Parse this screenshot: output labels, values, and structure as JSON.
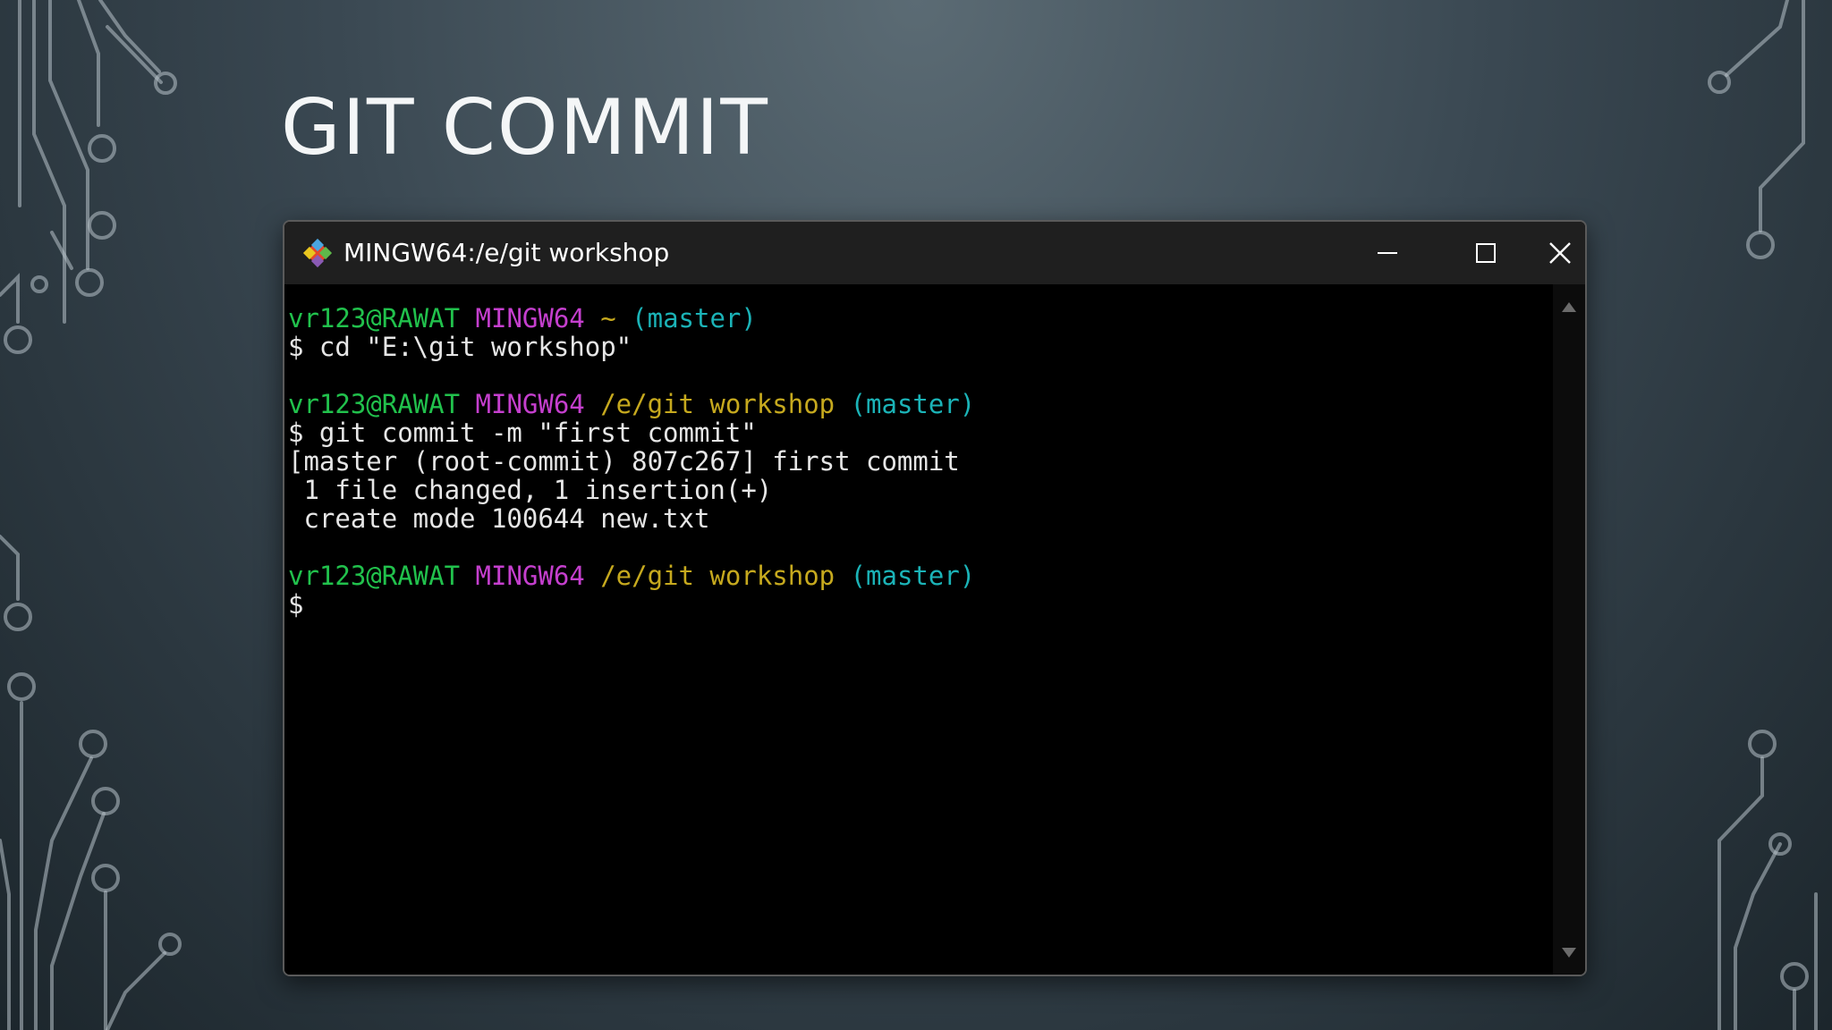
{
  "slide": {
    "title": "GIT COMMIT"
  },
  "window": {
    "title": "MINGW64:/e/git workshop",
    "icon": "git-for-windows-icon",
    "buttons": [
      "minimize-icon",
      "maximize-icon",
      "close-icon"
    ]
  },
  "terminal": {
    "lines": [
      [
        {
          "text": "vr123@RAWAT",
          "role": "user"
        },
        {
          "text": " ",
          "role": "plain"
        },
        {
          "text": "MINGW64",
          "role": "host"
        },
        {
          "text": " ",
          "role": "plain"
        },
        {
          "text": "~",
          "role": "path"
        },
        {
          "text": " ",
          "role": "plain"
        },
        {
          "text": "(master)",
          "role": "branch"
        }
      ],
      [
        {
          "text": "$ cd \"E:\\git workshop\"",
          "role": "plain"
        }
      ],
      [],
      [
        {
          "text": "vr123@RAWAT",
          "role": "user"
        },
        {
          "text": " ",
          "role": "plain"
        },
        {
          "text": "MINGW64",
          "role": "host"
        },
        {
          "text": " ",
          "role": "plain"
        },
        {
          "text": "/e/git workshop",
          "role": "path"
        },
        {
          "text": " ",
          "role": "plain"
        },
        {
          "text": "(master)",
          "role": "branch"
        }
      ],
      [
        {
          "text": "$ git commit -m \"first commit\"",
          "role": "plain"
        }
      ],
      [
        {
          "text": "[master (root-commit) 807c267] first commit",
          "role": "plain"
        }
      ],
      [
        {
          "text": " 1 file changed, 1 insertion(+)",
          "role": "plain"
        }
      ],
      [
        {
          "text": " create mode 100644 new.txt",
          "role": "plain"
        }
      ],
      [],
      [
        {
          "text": "vr123@RAWAT",
          "role": "user"
        },
        {
          "text": " ",
          "role": "plain"
        },
        {
          "text": "MINGW64",
          "role": "host"
        },
        {
          "text": " ",
          "role": "plain"
        },
        {
          "text": "/e/git workshop",
          "role": "path"
        },
        {
          "text": " ",
          "role": "plain"
        },
        {
          "text": "(master)",
          "role": "branch"
        }
      ],
      [
        {
          "text": "$",
          "role": "plain"
        }
      ]
    ]
  },
  "colors": {
    "user": "#21c14c",
    "host": "#c53fce",
    "path": "#c6a91e",
    "branch": "#1bb3b7",
    "plain": "#e6e6e6"
  }
}
